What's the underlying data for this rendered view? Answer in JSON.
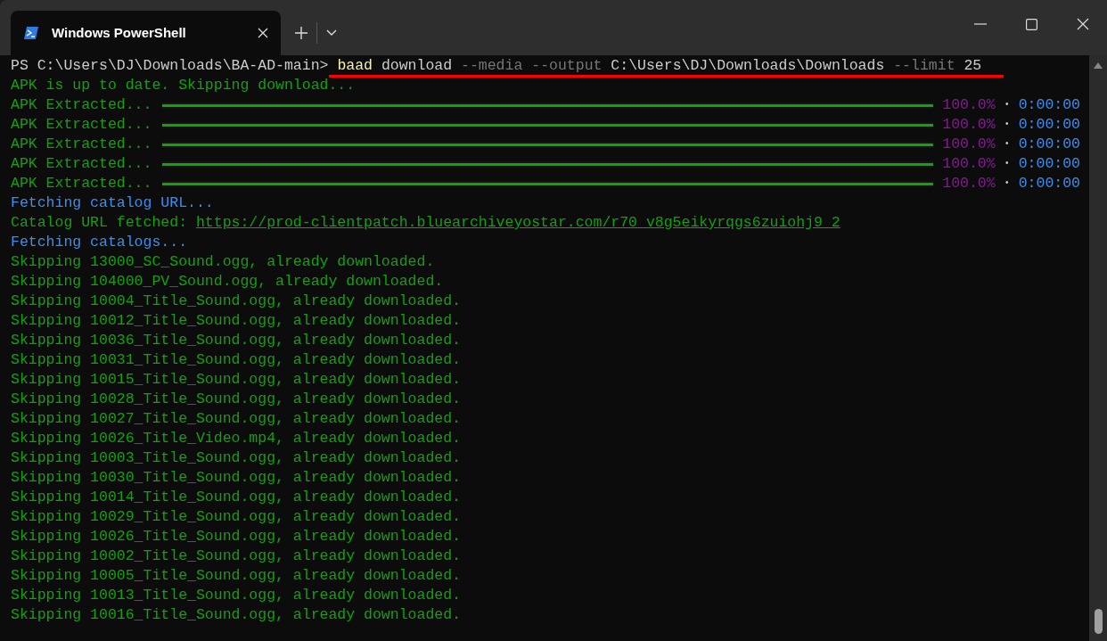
{
  "tab": {
    "title": "Windows PowerShell",
    "selected": true
  },
  "prompt": {
    "segments": [
      {
        "kind": "prompt",
        "text": "PS C:\\Users\\DJ\\Downloads\\BA-AD-main> "
      },
      {
        "kind": "command",
        "text": "baad"
      },
      {
        "kind": "arg",
        "text": " download "
      },
      {
        "kind": "flag",
        "text": "--media"
      },
      {
        "kind": "flag",
        "text": " --output"
      },
      {
        "kind": "arg",
        "text": " C:\\Users\\DJ\\Downloads\\Downloads "
      },
      {
        "kind": "flag",
        "text": "--limit"
      },
      {
        "kind": "arg",
        "text": " 25"
      }
    ]
  },
  "lines": [
    {
      "kind": "ok",
      "text": "APK is up to date. Skipping download..."
    },
    {
      "kind": "progress",
      "text": "APK Extracted...",
      "level": 1,
      "percent": "100.0%",
      "separator": "•",
      "eta": "0:00:00"
    },
    {
      "kind": "progress",
      "text": "APK Extracted...",
      "level": 1,
      "percent": "100.0%",
      "separator": "•",
      "eta": "0:00:00"
    },
    {
      "kind": "progress",
      "text": "APK Extracted...",
      "level": 1,
      "percent": "100.0%",
      "separator": "•",
      "eta": "0:00:00"
    },
    {
      "kind": "progress",
      "text": "APK Extracted...",
      "level": 1,
      "percent": "100.0%",
      "separator": "•",
      "eta": "0:00:00"
    },
    {
      "kind": "progress",
      "text": "APK Extracted...",
      "level": 1,
      "percent": "100.0%",
      "separator": "•",
      "eta": "0:00:00"
    },
    {
      "kind": "info",
      "text": "Fetching catalog URL..."
    },
    {
      "kind": "link",
      "text": "Catalog URL fetched: ",
      "link": "https://prod-clientpatch.bluearchiveyostar.com/r70_v8g5eikyrqgs6zuiohj9_2"
    },
    {
      "kind": "info",
      "text": "Fetching catalogs..."
    },
    {
      "kind": "ok",
      "text": "Skipping 13000_SC_Sound.ogg, already downloaded."
    },
    {
      "kind": "ok",
      "text": "Skipping 104000_PV_Sound.ogg, already downloaded."
    },
    {
      "kind": "ok",
      "text": "Skipping 10004_Title_Sound.ogg, already downloaded."
    },
    {
      "kind": "ok",
      "text": "Skipping 10012_Title_Sound.ogg, already downloaded."
    },
    {
      "kind": "ok",
      "text": "Skipping 10036_Title_Sound.ogg, already downloaded."
    },
    {
      "kind": "ok",
      "text": "Skipping 10031_Title_Sound.ogg, already downloaded."
    },
    {
      "kind": "ok",
      "text": "Skipping 10015_Title_Sound.ogg, already downloaded."
    },
    {
      "kind": "ok",
      "text": "Skipping 10028_Title_Sound.ogg, already downloaded."
    },
    {
      "kind": "ok",
      "text": "Skipping 10027_Title_Sound.ogg, already downloaded."
    },
    {
      "kind": "ok",
      "text": "Skipping 10026_Title_Video.mp4, already downloaded."
    },
    {
      "kind": "ok",
      "text": "Skipping 10003_Title_Sound.ogg, already downloaded."
    },
    {
      "kind": "ok",
      "text": "Skipping 10030_Title_Sound.ogg, already downloaded."
    },
    {
      "kind": "ok",
      "text": "Skipping 10014_Title_Sound.ogg, already downloaded."
    },
    {
      "kind": "ok",
      "text": "Skipping 10029_Title_Sound.ogg, already downloaded."
    },
    {
      "kind": "ok",
      "text": "Skipping 10026_Title_Sound.ogg, already downloaded."
    },
    {
      "kind": "ok",
      "text": "Skipping 10002_Title_Sound.ogg, already downloaded."
    },
    {
      "kind": "ok",
      "text": "Skipping 10005_Title_Sound.ogg, already downloaded."
    },
    {
      "kind": "ok",
      "text": "Skipping 10013_Title_Sound.ogg, already downloaded."
    },
    {
      "kind": "ok",
      "text": "Skipping 10016_Title_Sound.ogg, already downloaded."
    }
  ]
}
